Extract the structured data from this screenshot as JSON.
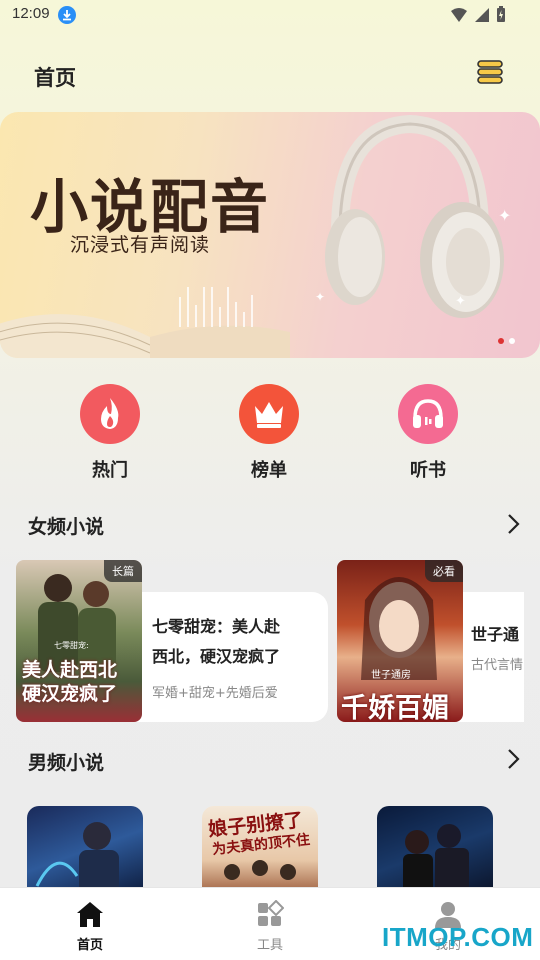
{
  "status_bar": {
    "time": "12:09"
  },
  "header": {
    "title": "首页"
  },
  "banner": {
    "title": "小说配音",
    "subtitle": "沉浸式有声阅读",
    "page_count": 2,
    "active_index": 0
  },
  "quick_entries": [
    {
      "label": "热门",
      "icon": "flame-icon",
      "color": "#f25a5f"
    },
    {
      "label": "榜单",
      "icon": "crown-icon",
      "color": "#f3543a"
    },
    {
      "label": "听书",
      "icon": "headphones-icon",
      "color": "#f46a92"
    }
  ],
  "female_section": {
    "title": "女频小说",
    "books": [
      {
        "badge": "长篇",
        "title": "七零甜宠：美人赴西北，硬汉宠疯了",
        "title_line1": "七零甜宠：美人赴",
        "title_line2": "西北，硬汉宠疯了",
        "tags": "军婚+甜宠+先婚后爱",
        "cover_text": "美人赴西北 硬汉宠疯了",
        "cover_text_1": "美人赴西北",
        "cover_text_2": "硬汉宠疯了",
        "cover_small": "七零甜宠:"
      },
      {
        "badge": "必看",
        "title_line1": "世子通",
        "tags": "古代言情",
        "cover_text_1": "世子通房",
        "cover_text_2": "千娇百媚"
      }
    ]
  },
  "male_section": {
    "title": "男频小说",
    "covers": [
      {
        "name": "cover-1"
      },
      {
        "name": "cover-2",
        "text_1": "娘子别撩了",
        "text_2": "为夫真的顶不住"
      },
      {
        "name": "cover-3"
      }
    ]
  },
  "bottom_nav": [
    {
      "label": "首页",
      "icon": "home-icon",
      "active": true
    },
    {
      "label": "工具",
      "icon": "grid-icon",
      "active": false
    },
    {
      "label": "我的",
      "icon": "user-icon",
      "active": false
    }
  ],
  "watermark": "ITMOP.COM",
  "colors": {
    "accent": "#f25a5f",
    "banner_text": "#3a2418",
    "watermark": "#18a6c9"
  }
}
